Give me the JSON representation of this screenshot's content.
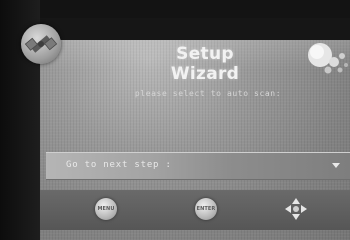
{
  "wizard": {
    "title": "Setup Wizard",
    "subtitle": "please select to auto scan:",
    "next_step_label": "Go to next step :"
  },
  "buttons": {
    "menu": "MENU",
    "enter": "ENTER"
  },
  "icons": {
    "logo": "satellite-icon",
    "corner": "planet-icon",
    "navigation": "dpad-arrows-icon",
    "dropdown": "chevron-down-icon"
  },
  "colors": {
    "screen": "#929292",
    "text": "#f2f2f2",
    "bottom_bar": "#5f5f5f"
  }
}
